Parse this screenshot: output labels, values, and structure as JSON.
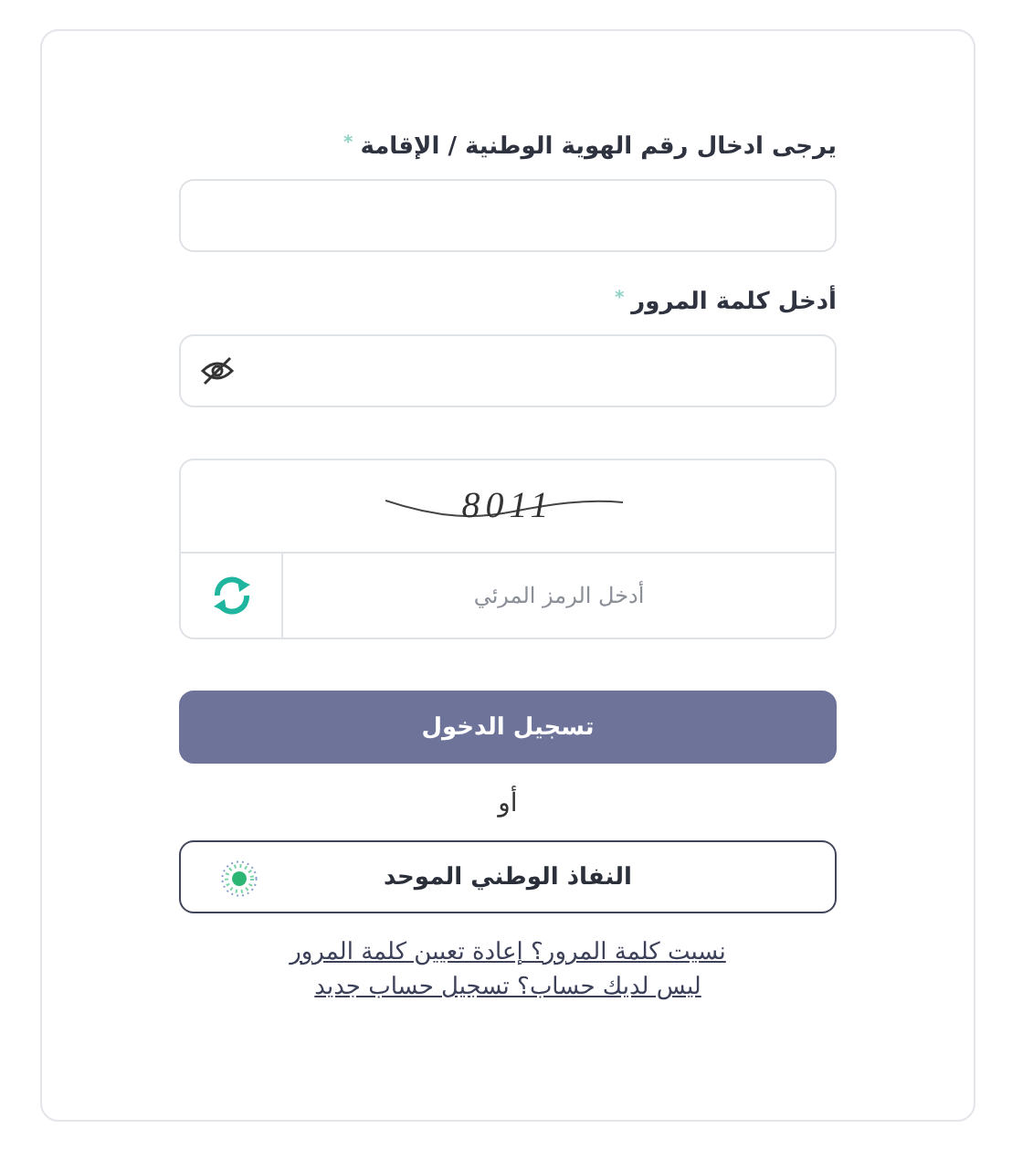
{
  "id_field": {
    "label": "يرجى ادخال رقم الهوية الوطنية / الإقامة",
    "required_mark": "*"
  },
  "password_field": {
    "label": "أدخل كلمة المرور",
    "required_mark": "*"
  },
  "captcha": {
    "code": "8011",
    "placeholder": "أدخل الرمز المرئي"
  },
  "login_button": "تسجيل الدخول",
  "separator": "أو",
  "nafath_button": "النفاذ الوطني الموحد",
  "links": [
    "نسيت كلمة المرور؟ إعادة تعيين كلمة المرور",
    "ليس لديك حساب؟ تسجيل حساب جديد"
  ]
}
